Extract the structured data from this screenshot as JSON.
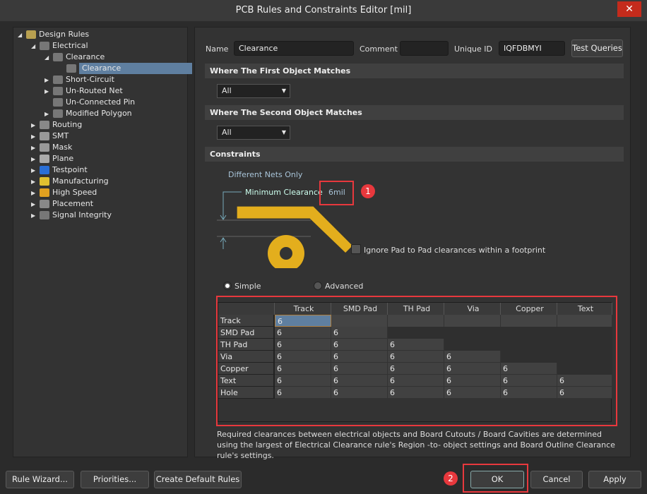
{
  "window": {
    "title": "PCB Rules and Constraints Editor [mil]",
    "close": "✕"
  },
  "tree": [
    {
      "label": "Design Rules",
      "level": 0,
      "expand": "◢",
      "icon": "design-rules-folder-icon",
      "color": "#b8a050"
    },
    {
      "label": "Electrical",
      "level": 1,
      "expand": "◢",
      "icon": "electrical-icon",
      "color": "#777"
    },
    {
      "label": "Clearance",
      "level": 2,
      "expand": "◢",
      "icon": "electrical-icon",
      "color": "#777"
    },
    {
      "label": "Clearance",
      "level": 3,
      "expand": "",
      "icon": "electrical-icon",
      "color": "#777",
      "selected": true
    },
    {
      "label": "Short-Circuit",
      "level": 2,
      "expand": "▶",
      "icon": "electrical-icon",
      "color": "#777"
    },
    {
      "label": "Un-Routed Net",
      "level": 2,
      "expand": "▶",
      "icon": "electrical-icon",
      "color": "#777"
    },
    {
      "label": "Un-Connected Pin",
      "level": 2,
      "expand": "",
      "icon": "electrical-icon",
      "color": "#777"
    },
    {
      "label": "Modified Polygon",
      "level": 2,
      "expand": "▶",
      "icon": "electrical-icon",
      "color": "#777"
    },
    {
      "label": "Routing",
      "level": 1,
      "expand": "▶",
      "icon": "routing-icon",
      "color": "#888"
    },
    {
      "label": "SMT",
      "level": 1,
      "expand": "▶",
      "icon": "smt-icon",
      "color": "#999"
    },
    {
      "label": "Mask",
      "level": 1,
      "expand": "▶",
      "icon": "mask-icon",
      "color": "#999"
    },
    {
      "label": "Plane",
      "level": 1,
      "expand": "▶",
      "icon": "plane-icon",
      "color": "#aaa"
    },
    {
      "label": "Testpoint",
      "level": 1,
      "expand": "▶",
      "icon": "testpoint-icon",
      "color": "#2a6fd6"
    },
    {
      "label": "Manufacturing",
      "level": 1,
      "expand": "▶",
      "icon": "manufacturing-icon",
      "color": "#e0c030"
    },
    {
      "label": "High Speed",
      "level": 1,
      "expand": "▶",
      "icon": "high-speed-icon",
      "color": "#e0a020"
    },
    {
      "label": "Placement",
      "level": 1,
      "expand": "▶",
      "icon": "placement-icon",
      "color": "#888"
    },
    {
      "label": "Signal Integrity",
      "level": 1,
      "expand": "▶",
      "icon": "signal-integrity-icon",
      "color": "#777"
    }
  ],
  "rule": {
    "name_label": "Name",
    "name": "Clearance",
    "comment_label": "Comment",
    "comment": "",
    "uid_label": "Unique ID",
    "uid": "IQFDBMYI",
    "test_queries": "Test Queries"
  },
  "first": {
    "title": "Where The First Object Matches",
    "value": "All"
  },
  "second": {
    "title": "Where The Second Object Matches",
    "value": "All"
  },
  "constraints": {
    "title": "Constraints",
    "different_nets": "Different Nets Only",
    "min_clearance_label": "Minimum Clearance",
    "min_clearance": "6mil",
    "ignore_pad": "Ignore Pad to Pad clearances within a footprint",
    "ignore_pad_checked": false,
    "simple": "Simple",
    "advanced": "Advanced",
    "mode": "Simple"
  },
  "matrix": {
    "columns": [
      "Track",
      "SMD Pad",
      "TH Pad",
      "Via",
      "Copper",
      "Text"
    ],
    "rows": [
      {
        "name": "Track",
        "values": [
          "6"
        ]
      },
      {
        "name": "SMD Pad",
        "values": [
          "6",
          "6"
        ]
      },
      {
        "name": "TH Pad",
        "values": [
          "6",
          "6",
          "6"
        ]
      },
      {
        "name": "Via",
        "values": [
          "6",
          "6",
          "6",
          "6"
        ]
      },
      {
        "name": "Copper",
        "values": [
          "6",
          "6",
          "6",
          "6",
          "6"
        ]
      },
      {
        "name": "Text",
        "values": [
          "6",
          "6",
          "6",
          "6",
          "6",
          "6"
        ]
      },
      {
        "name": "Hole",
        "values": [
          "6",
          "6",
          "6",
          "6",
          "6",
          "6"
        ]
      }
    ]
  },
  "note": "Required clearances between electrical objects and Board Cutouts / Board Cavities are determined using the largest of Electrical Clearance rule's Region -to- object settings and Board Outline Clearance rule's settings.",
  "annotations": {
    "badge1": "1",
    "badge2": "2",
    "color": "#e8383d"
  },
  "footer": {
    "rule_wizard": "Rule Wizard...",
    "priorities": "Priorities...",
    "create_default": "Create Default Rules",
    "ok": "OK",
    "cancel": "Cancel",
    "apply": "Apply"
  },
  "colors": {
    "copper": "#e3ae1d",
    "selection": "#5f7fa0"
  }
}
